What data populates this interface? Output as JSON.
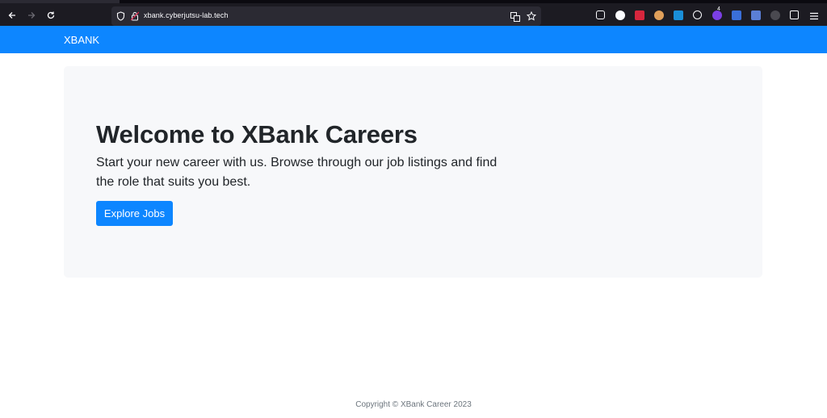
{
  "browser": {
    "url_host": "xbank.cyberjutsu-lab.tech",
    "badge_count": "4"
  },
  "navbar": {
    "brand": "XBANK"
  },
  "hero": {
    "title": "Welcome to XBank Careers",
    "lead": "Start your new career with us. Browse through our job listings and find the role that suits you best.",
    "button": "Explore Jobs"
  },
  "footer": {
    "copyright": "Copyright © XBank Career 2023"
  },
  "icons": {
    "back": "back-arrow-icon",
    "forward": "forward-arrow-icon",
    "reload": "reload-icon",
    "shield": "tracking-shield-icon",
    "lock": "lock-icon",
    "translate": "translate-icon",
    "bookmark": "star-icon",
    "menu": "hamburger-menu-icon"
  },
  "colors": {
    "brand_blue": "#0d86ff",
    "hero_bg": "#f7f8fa",
    "text": "#212529",
    "footer_text": "#6c757d"
  }
}
